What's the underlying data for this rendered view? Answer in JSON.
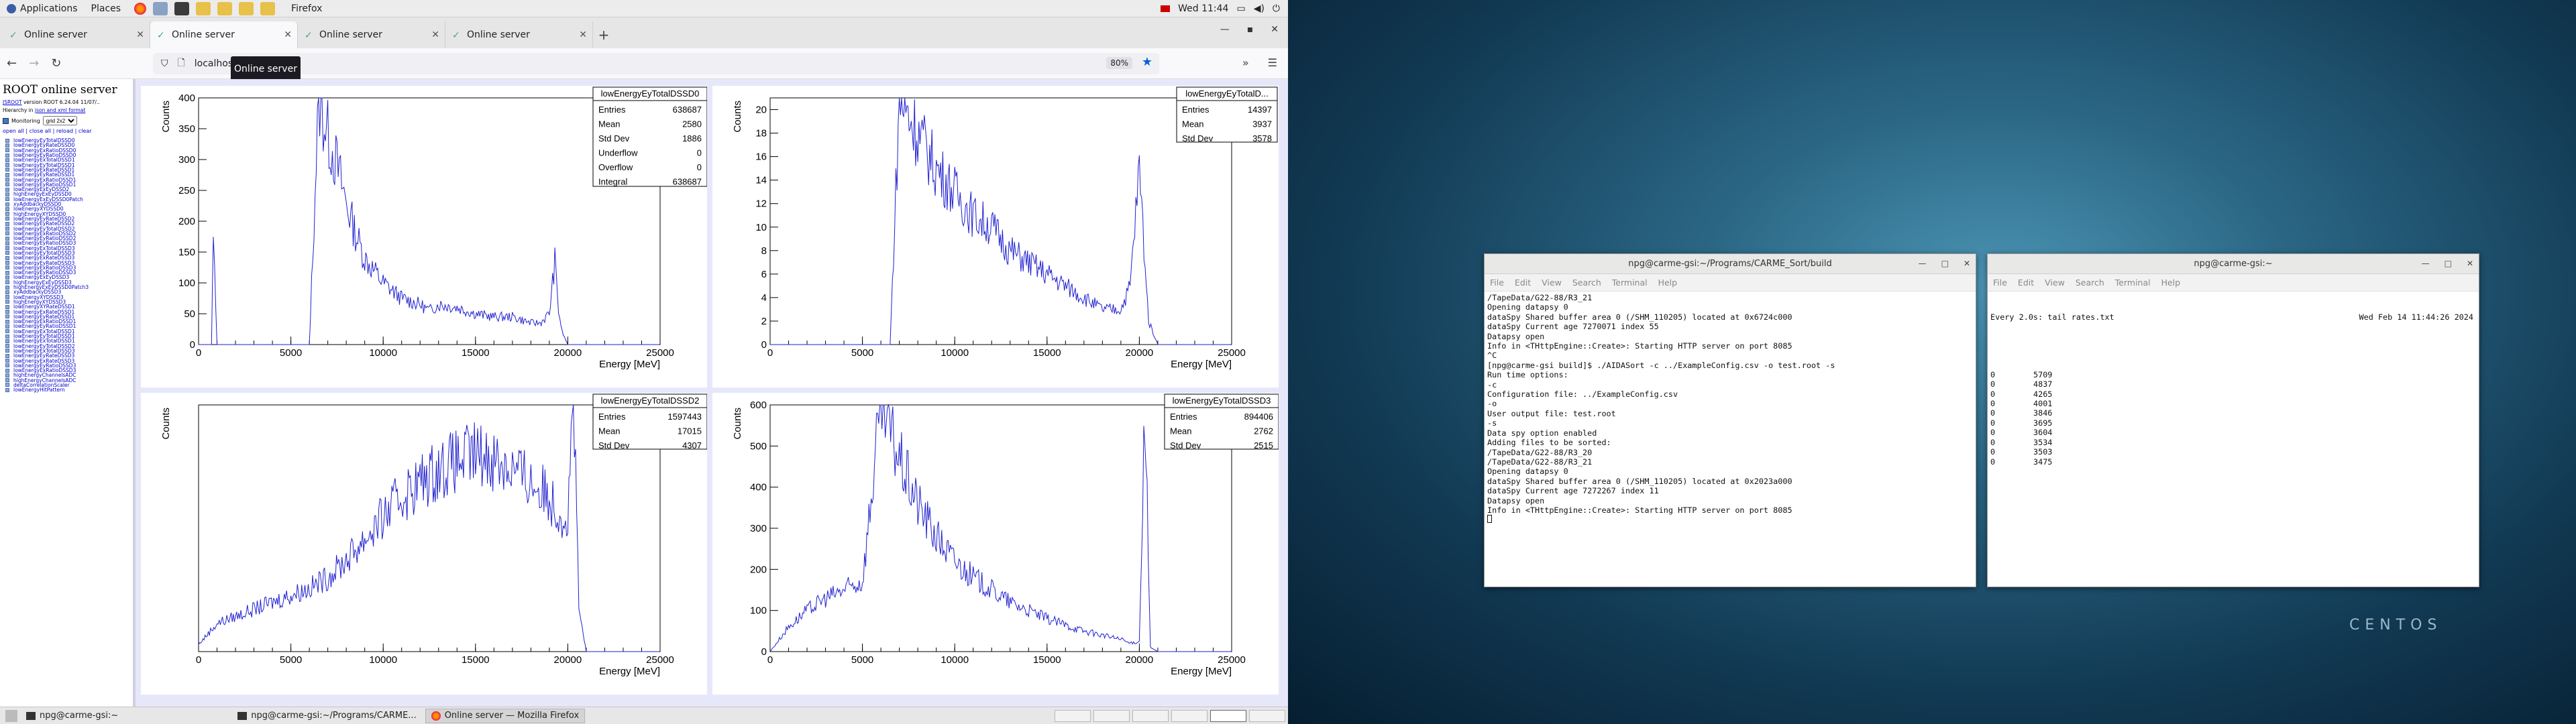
{
  "topbar": {
    "applications": "Applications",
    "places": "Places",
    "firefox": "Firefox",
    "clock": "Wed 11:44"
  },
  "firefox": {
    "tabs": [
      {
        "label": "Online server"
      },
      {
        "label": "Online server"
      },
      {
        "label": "Online server"
      },
      {
        "label": "Online server"
      }
    ],
    "tooltip": "Online server",
    "url": "localhost",
    "zoom": "80%"
  },
  "sidebar": {
    "title": "ROOT online server",
    "version_prefix": "JSROOT",
    "version_text": "version ROOT 6.24.04 11/07/..",
    "hier_text": "Hierarchy in",
    "hier_links": "json and xml format",
    "monitor_label": "Monitoring",
    "monitor_value": "grid 2x2",
    "links": "open all | close all | reload | clear",
    "items": [
      "lowEnergyEyTotalDSSD0",
      "lowEnergyEyRateDSSD0",
      "lowEnergyExRatioDSSD0",
      "lowEnergyEyRatioDSSD0",
      "lowEnergyExTotalDSSD1",
      "lowEnergyEyTotalDSSD1",
      "lowEnergyExRateDSSD1",
      "lowEnergyEyRateDSSD1",
      "lowEnergyExRatioDSSD1",
      "lowEnergyEyRatioDSSD1",
      "lowEnergyExEyDSSD2",
      "highEnergyExEyDSSD0",
      "lowEnergyExEyDSSD0Patch",
      "xyAddbackyDSSD0",
      "lowEnergyXYDSSD0",
      "highEnergyXYDSSD0",
      "lowEnergyEyRateDSSD2",
      "lowEnergyEyRateDSSD2",
      "lowEnergyEyTotalDSSD2",
      "lowEnergyExRatioDSSD2",
      "lowEnergyEyRatioDSSD2",
      "lowEnergyEyRatioDSSD3",
      "lowEnergyExTotalDSSD3",
      "lowEnergyEyTotalDSSD3",
      "lowEnergyExRateDSSD3",
      "lowEnergyEyRateDSSD3",
      "lowEnergyExRatioDSSD3",
      "lowEnergyEyRatioDSSD3",
      "lowEnergyExEyDSSD3",
      "highEnergyExEyDSSD3",
      "highEnergyExEyDSSD0Patch3",
      "xyAddbackyDSSD3",
      "lowEnergyXYDSSD3",
      "highEnergyXYDSSD3",
      "lowEnergyXYRateDSSD1",
      "lowEnergyExRateDSSD1",
      "lowEnergyEyRateDSSD1",
      "lowEnergyExRatioDSSD1",
      "lowEnergyEyRatioDSSD1",
      "lowEnergyExTotalDSSD1",
      "lowEnergyEyTotalDSSD1",
      "lowEnergyExTotalDSSD1",
      "lowEnergyEyTotalDSSD2",
      "lowEnergyExTotalDSSD3",
      "lowEnergyEyRateDSSD3",
      "lowEnergyExRateDSSD3",
      "lowEnergyEyRatioDSSD3",
      "lowEnergyExRatioDSSD3",
      "highEnergyChannelsADC",
      "highEnergyChannelsADC",
      "deltaCorrelationScaler",
      "lowEnergyHitPattern"
    ]
  },
  "chart_data": [
    {
      "type": "line",
      "title": "lowEnergyEyTotalDSSD0",
      "xlabel": "Energy [MeV]",
      "ylabel": "Counts",
      "xlim": [
        0,
        25000
      ],
      "ylim": [
        0,
        400
      ],
      "xticks": [
        "0",
        "5000",
        "10000",
        "15000",
        "20000",
        "25000"
      ],
      "yticks": [
        "0",
        "50",
        "100",
        "150",
        "200",
        "250",
        "300",
        "350",
        "400"
      ],
      "x": [
        0,
        700,
        800,
        1000,
        1500,
        2000,
        3000,
        4000,
        5000,
        6000,
        6500,
        7000,
        7500,
        8000,
        8500,
        9000,
        10000,
        11000,
        12000,
        12500,
        13000,
        14000,
        15000,
        16000,
        17000,
        18000,
        18500,
        19000,
        19300,
        19500,
        19700,
        20000,
        21000,
        25000
      ],
      "y": [
        0,
        0,
        170,
        0,
        0,
        0,
        0,
        0,
        0,
        0,
        400,
        340,
        290,
        230,
        180,
        140,
        100,
        75,
        65,
        55,
        65,
        60,
        50,
        45,
        45,
        35,
        35,
        50,
        135,
        55,
        20,
        0,
        0,
        0
      ],
      "stats": [
        [
          "Entries",
          "638687"
        ],
        [
          "Mean",
          "2580"
        ],
        [
          "Std Dev",
          "1886"
        ],
        [
          "Underflow",
          "0"
        ],
        [
          "Overflow",
          "0"
        ],
        [
          "Integral",
          "638687"
        ]
      ]
    },
    {
      "type": "line",
      "title": "lowEnergyEyTotalD...",
      "xlabel": "Energy [MeV]",
      "ylabel": "Counts",
      "xlim": [
        0,
        25000
      ],
      "ylim": [
        0,
        21
      ],
      "xticks": [
        "0",
        "5000",
        "10000",
        "15000",
        "20000",
        "25000"
      ],
      "yticks": [
        "0",
        "2",
        "4",
        "6",
        "8",
        "10",
        "12",
        "14",
        "16",
        "18",
        "20"
      ],
      "x": [
        0,
        3000,
        5000,
        6500,
        7000,
        8000,
        9000,
        10000,
        11000,
        12000,
        13000,
        14000,
        15000,
        16000,
        17000,
        18000,
        19000,
        19500,
        20000,
        20500,
        21000,
        25000
      ],
      "y": [
        0,
        0,
        0,
        0,
        21,
        18,
        15,
        13,
        11,
        10,
        8,
        7,
        6,
        5,
        4,
        3,
        3,
        5,
        15,
        2,
        0,
        0
      ],
      "stats": [
        [
          "Entries",
          "14397"
        ],
        [
          "Mean",
          "3937"
        ],
        [
          "Std Dev",
          "3578"
        ]
      ]
    },
    {
      "type": "line",
      "title": "lowEnergyEyTotalDSSD2",
      "xlabel": "Energy [MeV]",
      "ylabel": "Counts",
      "xlim": [
        0,
        25000
      ],
      "ylim": [
        0,
        70
      ],
      "xticks": [
        "0",
        "5000",
        "10000",
        "15000",
        "20000",
        "25000"
      ],
      "yticks": [],
      "x": [
        0,
        1000,
        2000,
        3000,
        4000,
        5000,
        6000,
        7000,
        8000,
        9000,
        10000,
        11000,
        12000,
        13000,
        14000,
        15000,
        16000,
        17000,
        18000,
        19000,
        19500,
        20000,
        20300,
        20600,
        21000,
        25000
      ],
      "y": [
        2,
        8,
        10,
        12,
        14,
        16,
        18,
        21,
        26,
        32,
        38,
        44,
        48,
        52,
        54,
        56,
        55,
        52,
        48,
        44,
        40,
        37,
        75,
        12,
        0,
        0
      ],
      "stats": [
        [
          "Entries",
          "1597443"
        ],
        [
          "Mean",
          "17015"
        ],
        [
          "Std Dev",
          "4307"
        ]
      ]
    },
    {
      "type": "line",
      "title": "lowEnergyEyTotalDSSD3",
      "xlabel": "Energy [MeV]",
      "ylabel": "Counts",
      "xlim": [
        0,
        25000
      ],
      "ylim": [
        0,
        600
      ],
      "xticks": [
        "0",
        "5000",
        "10000",
        "15000",
        "20000",
        "25000"
      ],
      "yticks": [
        "0",
        "100",
        "200",
        "300",
        "400",
        "500",
        "600"
      ],
      "x": [
        0,
        500,
        1000,
        2000,
        3000,
        4000,
        5000,
        6000,
        7000,
        8000,
        9000,
        10000,
        11000,
        12000,
        13000,
        14000,
        15000,
        16000,
        17000,
        18000,
        19000,
        19500,
        20000,
        20300,
        20600,
        21000,
        25000
      ],
      "y": [
        0,
        30,
        60,
        100,
        130,
        150,
        170,
        600,
        470,
        360,
        280,
        220,
        180,
        150,
        120,
        100,
        80,
        65,
        50,
        40,
        30,
        20,
        25,
        600,
        10,
        0,
        0
      ],
      "stats": [
        [
          "Entries",
          "894406"
        ],
        [
          "Mean",
          "2762"
        ],
        [
          "Std Dev",
          "2515"
        ]
      ]
    }
  ],
  "terminal1": {
    "title": "npg@carme-gsi:~/Programs/CARME_Sort/build",
    "menu": [
      "File",
      "Edit",
      "View",
      "Search",
      "Terminal",
      "Help"
    ],
    "lines": [
      "/TapeData/G22-88/R3_21",
      "Opening datapsy 0",
      "dataSpy Shared buffer area 0 (/SHM_110205) located at 0x6724c000",
      "dataSpy Current age 7270071 index 55",
      "Datapsy open",
      "Info in <THttpEngine::Create>: Starting HTTP server on port 8085",
      "^C",
      "[npg@carme-gsi build]$ ./AIDASort -c ../ExampleConfig.csv -o test.root -s",
      "Run time options:",
      "-c",
      "Configuration file: ../ExampleConfig.csv",
      "-o",
      "User output file: test.root",
      "-s",
      "Data spy option enabled",
      "Adding files to be sorted:",
      "/TapeData/G22-88/R3_20",
      "/TapeData/G22-88/R3_21",
      "Opening datapsy 0",
      "dataSpy Shared buffer area 0 (/SHM_110205) located at 0x2023a000",
      "dataSpy Current age 7272267 index 11",
      "Datapsy open",
      "Info in <THttpEngine::Create>: Starting HTTP server on port 8085"
    ]
  },
  "terminal2": {
    "title": "npg@carme-gsi:~",
    "menu": [
      "File",
      "Edit",
      "View",
      "Search",
      "Terminal",
      "Help"
    ],
    "header_left": "Every 2.0s: tail rates.txt",
    "header_right": "Wed Feb 14 11:44:26 2024",
    "rows": [
      [
        "0",
        "5709"
      ],
      [
        "0",
        "4837"
      ],
      [
        "0",
        "4265"
      ],
      [
        "0",
        "4001"
      ],
      [
        "0",
        "3846"
      ],
      [
        "0",
        "3695"
      ],
      [
        "0",
        "3604"
      ],
      [
        "0",
        "3534"
      ],
      [
        "0",
        "3503"
      ],
      [
        "0",
        "3475"
      ]
    ]
  },
  "taskbar": {
    "items": [
      "npg@carme-gsi:~",
      "npg@carme-gsi:~/Programs/CARME...",
      "Online server — Mozilla Firefox"
    ]
  },
  "desktop": {
    "logo": "CENTOS"
  },
  "colors": {
    "histogram": "#2020d0",
    "page_bg": "#e6e8fa"
  }
}
